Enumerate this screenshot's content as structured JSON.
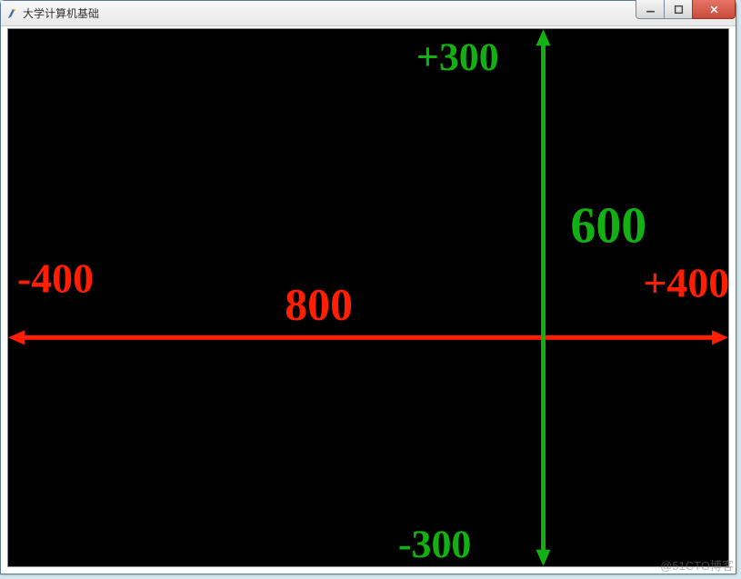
{
  "window": {
    "title": "大学计算机基础"
  },
  "diagram": {
    "x_axis": {
      "neg_label": "-400",
      "pos_label": "+400",
      "span_label": "800",
      "color": "#ff1e00"
    },
    "y_axis": {
      "neg_label": "-300",
      "pos_label": "+300",
      "span_label": "600",
      "color": "#13b013"
    }
  },
  "watermark": "@51CTO博客"
}
